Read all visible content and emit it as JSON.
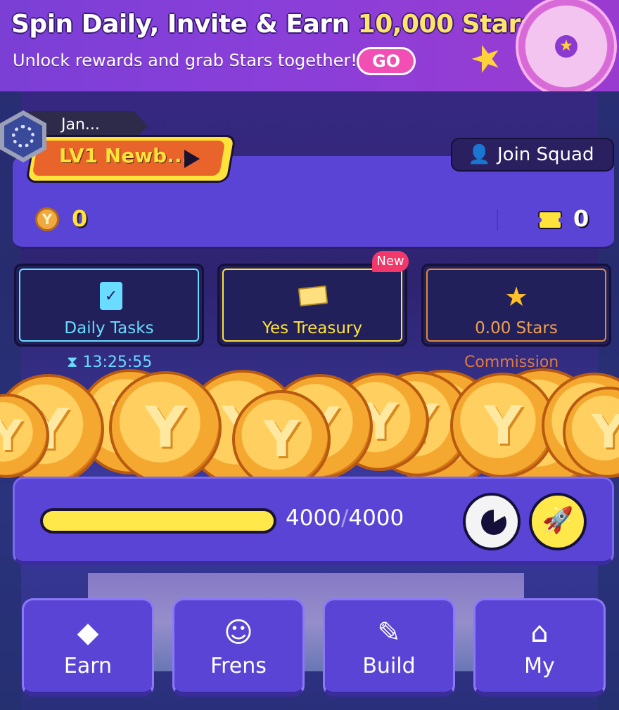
{
  "banner": {
    "title_prefix": "Spin Daily, Invite & Earn ",
    "title_highlight": "10,000 Stars",
    "subtitle": "Unlock rewards and grab Stars together!",
    "go_label": "GO",
    "wheel_icon": "spin-wheel-icon"
  },
  "profile": {
    "name": "Jan...",
    "level_label": "LV1 Newb...",
    "join_squad_label": "Join Squad",
    "coin_balance": "0",
    "coin_symbol": "Y",
    "ticket_balance": "0"
  },
  "tiles": {
    "daily_tasks": {
      "label": "Daily Tasks",
      "timer": "13:25:55",
      "icon": "clipboard-check-icon"
    },
    "treasury": {
      "label": "Yes Treasury",
      "badge": "New",
      "icon": "ticket-icon"
    },
    "stars": {
      "label": "0.00 Stars",
      "sub_label": "Commission",
      "icon": "star-icon"
    }
  },
  "coin_symbol": "Y",
  "energy": {
    "current": "4000",
    "separator": "/",
    "max": "4000",
    "fill_fraction": 1.0,
    "colors": {
      "fill": "#ffe94a",
      "track": "#1a1230"
    }
  },
  "nav": {
    "earn": "Earn",
    "frens": "Frens",
    "build": "Build",
    "my": "My"
  },
  "colors": {
    "accent_purple": "#5a44d6",
    "yellow": "#ffe23a",
    "cyan": "#6adcff",
    "orange": "#e08a3a",
    "pink": "#f24fb4",
    "new_badge": "#f2386a"
  }
}
